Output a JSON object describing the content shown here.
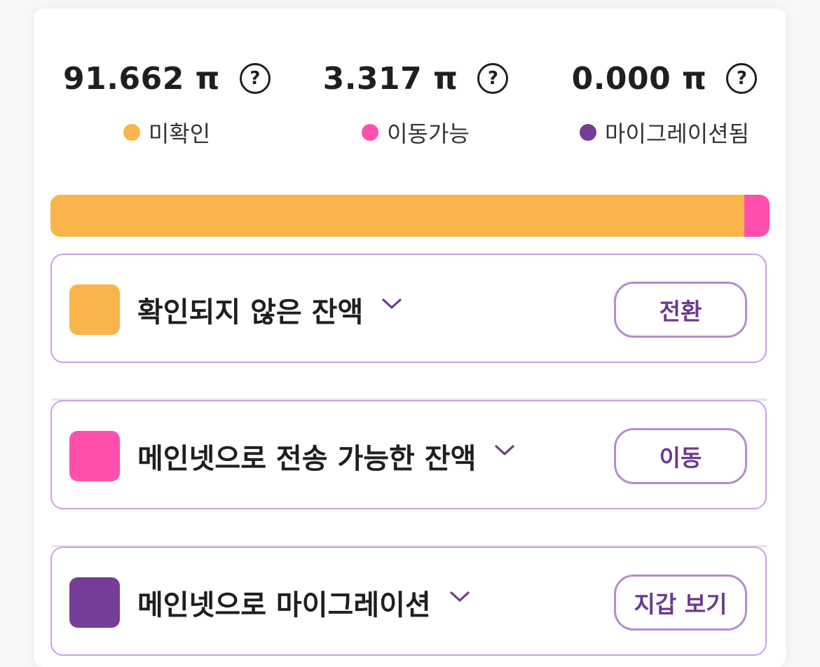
{
  "balances": [
    {
      "amount": "91.662 π",
      "legend": "미확인",
      "color": "#f9b44c"
    },
    {
      "amount": "3.317 π",
      "legend": "이동가능",
      "color": "#ff4fae"
    },
    {
      "amount": "0.000 π",
      "legend": "마이그레이션됨",
      "color": "#753d97"
    }
  ],
  "help_glyph": "?",
  "progress_bar": {
    "segments": [
      {
        "name": "unconfirmed",
        "fraction": 0.965,
        "color": "#f9b44c"
      },
      {
        "name": "transferable",
        "fraction": 0.035,
        "color": "#ff4fae"
      },
      {
        "name": "migrated",
        "fraction": 0.0,
        "color": "#753d97"
      }
    ]
  },
  "rows": [
    {
      "label": "확인되지 않은 잔액",
      "button": "전환",
      "color": "#f9b44c"
    },
    {
      "label": "메인넷으로 전송 가능한 잔액",
      "button": "이동",
      "color": "#ff4fae"
    },
    {
      "label": "메인넷으로 마이그레이션",
      "button": "지갑 보기",
      "color": "#753d97"
    }
  ],
  "colors": {
    "row_border": "#c9a0e6",
    "button_border": "#b38dcc",
    "button_text": "#6b3a8e"
  }
}
